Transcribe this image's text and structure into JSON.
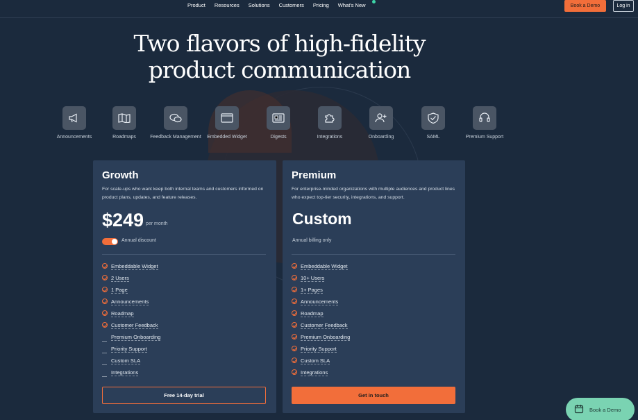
{
  "nav": {
    "links": [
      "Product",
      "Resources",
      "Solutions",
      "Customers",
      "Pricing",
      "What's New"
    ],
    "book_demo": "Book a Demo",
    "login": "Log in"
  },
  "hero": {
    "title_line1": "Two flavors of high-fidelity",
    "title_line2": "product communication"
  },
  "features": [
    {
      "label": "Announcements",
      "icon": "megaphone-icon"
    },
    {
      "label": "Roadmaps",
      "icon": "map-icon"
    },
    {
      "label": "Feedback Management",
      "icon": "chat-bubbles-icon"
    },
    {
      "label": "Embedded Widget",
      "icon": "window-icon"
    },
    {
      "label": "Digests",
      "icon": "newspaper-icon"
    },
    {
      "label": "Integrations",
      "icon": "puzzle-icon"
    },
    {
      "label": "Onboarding",
      "icon": "user-plus-icon"
    },
    {
      "label": "SAML",
      "icon": "shield-check-icon"
    },
    {
      "label": "Premium Support",
      "icon": "headset-icon"
    }
  ],
  "growth": {
    "title": "Growth",
    "description": "For scale-ups who want keep both internal teams and customers informed on product plans, updates, and feature releases.",
    "price": "$249",
    "per": "per month",
    "toggle_label": "Annual discount",
    "toggle_on": true,
    "items": [
      {
        "text": "Embeddable Widget",
        "included": true
      },
      {
        "text": "2 Users",
        "included": true
      },
      {
        "text": "1 Page",
        "included": true
      },
      {
        "text": "Announcements",
        "included": true
      },
      {
        "text": "Roadmap",
        "included": true
      },
      {
        "text": "Customer Feedback",
        "included": true
      },
      {
        "text": "Premium Onboarding",
        "included": false
      },
      {
        "text": "Priority Support",
        "included": false
      },
      {
        "text": "Custom SLA",
        "included": false
      },
      {
        "text": "Integrations",
        "included": false
      }
    ],
    "cta": "Free 14-day trial"
  },
  "premium": {
    "title": "Premium",
    "description": "For enterprise-minded organizations with multiple audiences and product lines who expect top-tier security, integrations, and support.",
    "price": "Custom",
    "billing": "Annual billing only",
    "items": [
      {
        "text": "Embeddable Widget",
        "included": true
      },
      {
        "text": "10+ Users",
        "included": true
      },
      {
        "text": "1+ Pages",
        "included": true
      },
      {
        "text": "Announcements",
        "included": true
      },
      {
        "text": "Roadmap",
        "included": true
      },
      {
        "text": "Customer Feedback",
        "included": true
      },
      {
        "text": "Premium Onboarding",
        "included": true
      },
      {
        "text": "Priority Support",
        "included": true
      },
      {
        "text": "Custom SLA",
        "included": true
      },
      {
        "text": "Integrations",
        "included": true
      }
    ],
    "cta": "Get in touch"
  },
  "floating": {
    "label": "Book a Demo"
  },
  "colors": {
    "accent": "#f26e3a",
    "background": "#1b2a3d",
    "card": "#2b3e58",
    "teal": "#7ad3b2"
  }
}
